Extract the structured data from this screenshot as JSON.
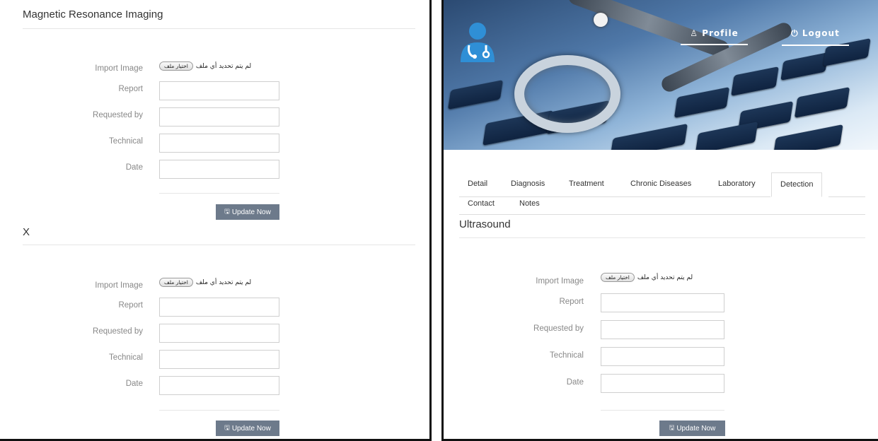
{
  "mri": {
    "title": "Magnetic Resonance Imaging",
    "form": {
      "import_label": "Import Image",
      "file_button": "اختيار ملف",
      "file_status": "لم يتم تحديد أي ملف",
      "report_label": "Report",
      "requested_label": "Requested by",
      "technical_label": "Technical",
      "date_label": "Date",
      "button": "Update Now"
    }
  },
  "x": {
    "title": "X",
    "form": {
      "import_label": "Import Image",
      "file_button": "اختيار ملف",
      "file_status": "لم يتم تحديد أي ملف",
      "report_label": "Report",
      "requested_label": "Requested by",
      "technical_label": "Technical",
      "date_label": "Date",
      "button": "Update Now"
    }
  },
  "header": {
    "nav": {
      "profile": "Profile",
      "logout": "Logout"
    },
    "icons": {
      "profile": "user-icon",
      "logout": "power-icon"
    }
  },
  "tabs": [
    "Detail",
    "Diagnosis",
    "Treatment",
    "Chronic Diseases",
    "Laboratory",
    "Detection",
    "Contact",
    "Notes"
  ],
  "active_tab": "Detection",
  "ultrasound": {
    "title": "Ultrasound",
    "form": {
      "import_label": "Import Image",
      "file_button": "اختيار ملف",
      "file_status": "لم يتم تحديد أي ملف",
      "report_label": "Report",
      "requested_label": "Requested by",
      "technical_label": "Technical",
      "date_label": "Date",
      "button": "Update Now"
    }
  },
  "colors": {
    "button": "#6d7a8b",
    "logo": "#2f8fd6"
  }
}
